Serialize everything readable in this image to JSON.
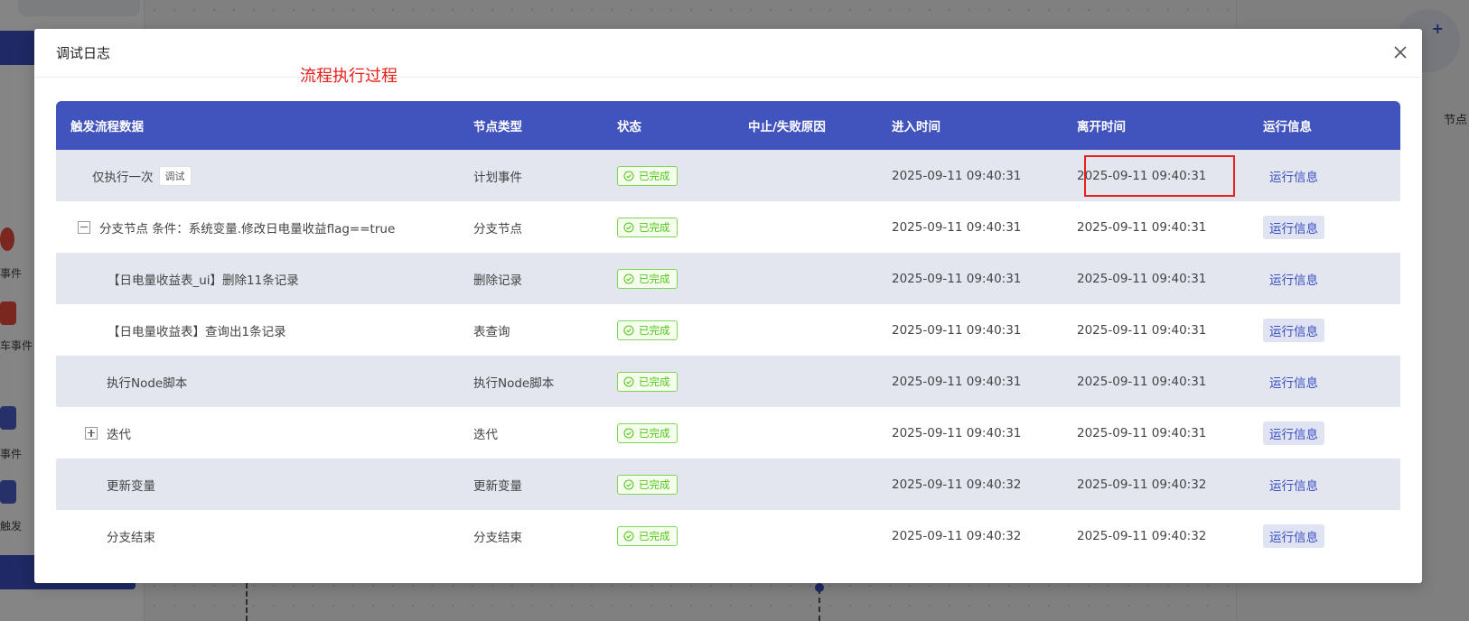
{
  "background": {
    "sidebar_items": [
      "事件",
      "车事件",
      "事件",
      "触发"
    ],
    "right_panel_label": "节点",
    "right_panel_plus": "+"
  },
  "modal": {
    "title": "调试日志",
    "annotation": "流程执行过程",
    "columns": [
      "触发流程数据",
      "节点类型",
      "状态",
      "中止/失败原因",
      "进入时间",
      "离开时间",
      "运行信息"
    ],
    "rows": [
      {
        "name": "仅执行一次",
        "tag": "调试",
        "type": "计划事件",
        "status": "已完成",
        "reason": "",
        "enter": "2025-09-11 09:40:31",
        "leave": "2025-09-11 09:40:31",
        "action": "运行信息"
      },
      {
        "name": "分支节点 条件：系统变量.修改日电量收益flag==true",
        "type": "分支节点",
        "status": "已完成",
        "reason": "",
        "enter": "2025-09-11 09:40:31",
        "leave": "2025-09-11 09:40:31",
        "action": "运行信息"
      },
      {
        "name": "【日电量收益表_ui】删除11条记录",
        "type": "删除记录",
        "status": "已完成",
        "reason": "",
        "enter": "2025-09-11 09:40:31",
        "leave": "2025-09-11 09:40:31",
        "action": "运行信息"
      },
      {
        "name": "【日电量收益表】查询出1条记录",
        "type": "表查询",
        "status": "已完成",
        "reason": "",
        "enter": "2025-09-11 09:40:31",
        "leave": "2025-09-11 09:40:31",
        "action": "运行信息"
      },
      {
        "name": "执行Node脚本",
        "type": "执行Node脚本",
        "status": "已完成",
        "reason": "",
        "enter": "2025-09-11 09:40:31",
        "leave": "2025-09-11 09:40:31",
        "action": "运行信息"
      },
      {
        "name": "迭代",
        "type": "迭代",
        "status": "已完成",
        "reason": "",
        "enter": "2025-09-11 09:40:31",
        "leave": "2025-09-11 09:40:31",
        "action": "运行信息"
      },
      {
        "name": "更新变量",
        "type": "更新变量",
        "status": "已完成",
        "reason": "",
        "enter": "2025-09-11 09:40:32",
        "leave": "2025-09-11 09:40:32",
        "action": "运行信息"
      },
      {
        "name": "分支结束",
        "type": "分支结束",
        "status": "已完成",
        "reason": "",
        "enter": "2025-09-11 09:40:32",
        "leave": "2025-09-11 09:40:32",
        "action": "运行信息"
      }
    ]
  },
  "colors": {
    "header_bg": "#4154bd",
    "status_green": "#52c41a",
    "highlight_red": "#e8201a",
    "link_blue": "#3b4fc2"
  },
  "icons": {
    "close": "close-icon",
    "status": "check-circle-icon",
    "collapse": "minus-square-icon",
    "expand": "plus-square-icon"
  }
}
